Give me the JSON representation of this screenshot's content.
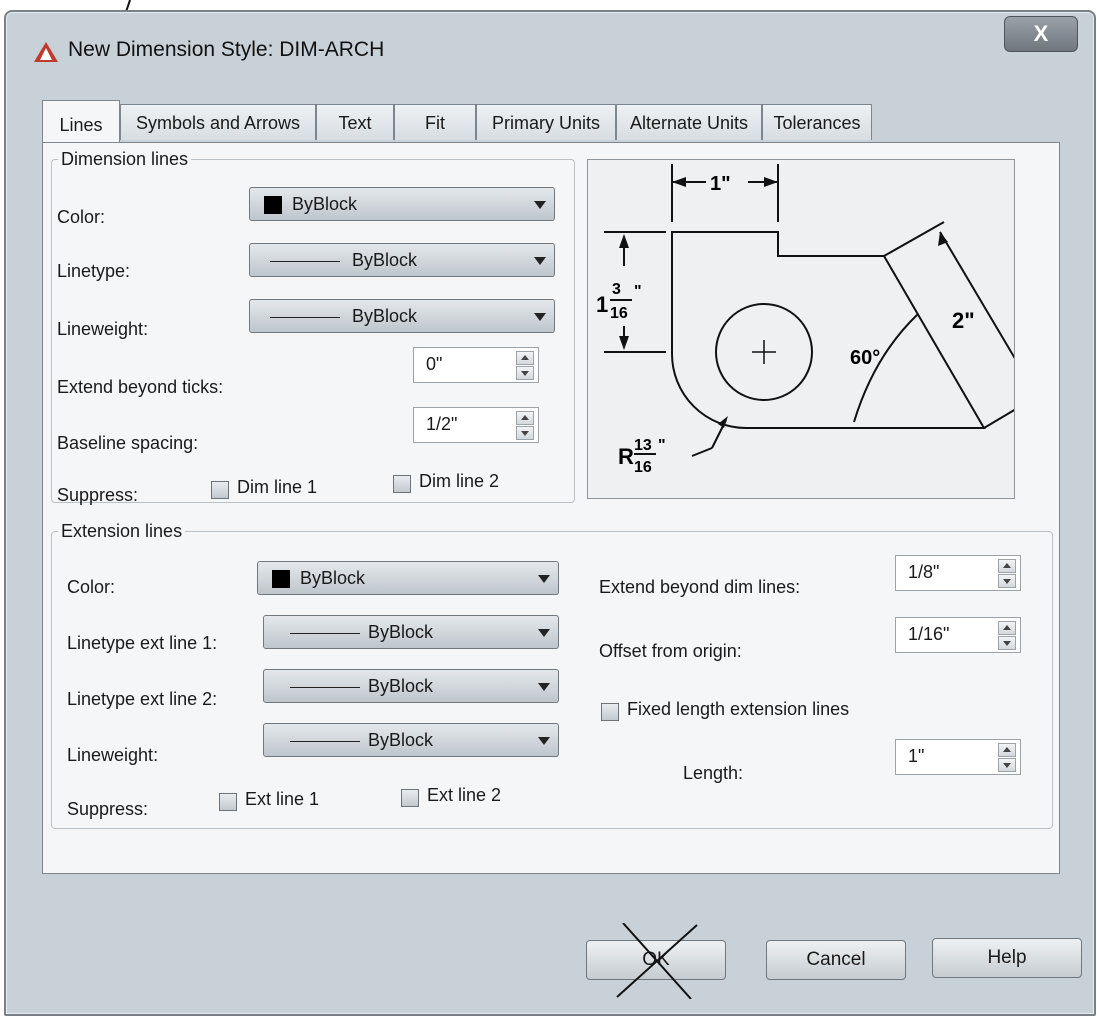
{
  "window": {
    "title": "New Dimension Style: DIM-ARCH",
    "close_label": "X"
  },
  "tabs": [
    "Lines",
    "Symbols and Arrows",
    "Text",
    "Fit",
    "Primary Units",
    "Alternate Units",
    "Tolerances"
  ],
  "dimension_lines": {
    "legend": "Dimension lines",
    "color_label": "Color:",
    "color_value": "ByBlock",
    "linetype_label": "Linetype:",
    "linetype_value": "ByBlock",
    "lineweight_label": "Lineweight:",
    "lineweight_value": "ByBlock",
    "extend_label": "Extend beyond ticks:",
    "extend_value": "0\"",
    "baseline_label": "Baseline spacing:",
    "baseline_value": "1/2\"",
    "suppress_label": "Suppress:",
    "dim_line1": "Dim line 1",
    "dim_line2": "Dim line 2"
  },
  "extension_lines": {
    "legend": "Extension lines",
    "color_label": "Color:",
    "color_value": "ByBlock",
    "linetype1_label": "Linetype ext line 1:",
    "linetype1_value": "ByBlock",
    "linetype2_label": "Linetype ext line 2:",
    "linetype2_value": "ByBlock",
    "lineweight_label": "Lineweight:",
    "lineweight_value": "ByBlock",
    "suppress_label": "Suppress:",
    "ext_line1": "Ext line 1",
    "ext_line2": "Ext line 2",
    "extend_dim_label": "Extend beyond dim lines:",
    "extend_dim_value": "1/8\"",
    "offset_label": "Offset from origin:",
    "offset_value": "1/16\"",
    "fixed_label": "Fixed length extension lines",
    "length_label": "Length:",
    "length_value": "1\""
  },
  "preview": {
    "dim_top": "1\"",
    "dim_right": "2\"",
    "angle": "60°",
    "left_whole": "1",
    "left_num": "3",
    "left_den": "16",
    "left_unit": "\"",
    "radius_prefix": "R",
    "radius_num": "13",
    "radius_den": "16",
    "radius_unit": "\""
  },
  "buttons": {
    "ok": "OK",
    "cancel": "Cancel",
    "help": "Help"
  }
}
